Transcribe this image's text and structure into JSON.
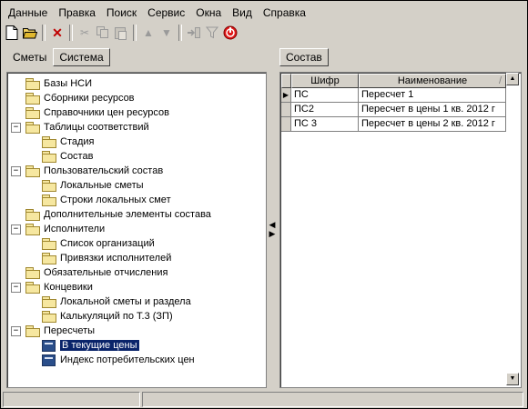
{
  "menu": [
    "Данные",
    "Правка",
    "Поиск",
    "Сервис",
    "Окна",
    "Вид",
    "Справка"
  ],
  "toolbar": {
    "icons": [
      "new-document-icon",
      "open-folder-icon",
      "delete-icon",
      "cut-icon",
      "copy-icon",
      "paste-icon",
      "move-up-icon",
      "move-down-icon",
      "import-icon",
      "filter-icon",
      "stop-icon"
    ]
  },
  "left_tabs": [
    "Сметы",
    "Система"
  ],
  "right_tab": "Состав",
  "tree": [
    {
      "label": "Базы НСИ",
      "level": 0,
      "expander": "",
      "icon": "folder"
    },
    {
      "label": "Сборники ресурсов",
      "level": 0,
      "expander": "",
      "icon": "folder"
    },
    {
      "label": "Справочники цен ресурсов",
      "level": 0,
      "expander": "",
      "icon": "folder"
    },
    {
      "label": "Таблицы соответствий",
      "level": 0,
      "expander": "−",
      "icon": "folder"
    },
    {
      "label": "Стадия",
      "level": 1,
      "expander": "",
      "icon": "folder"
    },
    {
      "label": "Состав",
      "level": 1,
      "expander": "",
      "icon": "folder"
    },
    {
      "label": "Пользовательский состав",
      "level": 0,
      "expander": "−",
      "icon": "folder"
    },
    {
      "label": "Локальные сметы",
      "level": 1,
      "expander": "",
      "icon": "folder"
    },
    {
      "label": "Строки локальных смет",
      "level": 1,
      "expander": "",
      "icon": "folder"
    },
    {
      "label": "Дополнительные элементы состава",
      "level": 0,
      "expander": "",
      "icon": "folder"
    },
    {
      "label": "Исполнители",
      "level": 0,
      "expander": "−",
      "icon": "folder"
    },
    {
      "label": "Список организаций",
      "level": 1,
      "expander": "",
      "icon": "folder"
    },
    {
      "label": "Привязки исполнителей",
      "level": 1,
      "expander": "",
      "icon": "folder"
    },
    {
      "label": "Обязательные отчисления",
      "level": 0,
      "expander": "",
      "icon": "folder"
    },
    {
      "label": "Концевики",
      "level": 0,
      "expander": "−",
      "icon": "folder"
    },
    {
      "label": "Локальной сметы и раздела",
      "level": 1,
      "expander": "",
      "icon": "folder"
    },
    {
      "label": "Калькуляций по Т.3 (ЗП)",
      "level": 1,
      "expander": "",
      "icon": "folder"
    },
    {
      "label": "Пересчеты",
      "level": 0,
      "expander": "−",
      "icon": "folder"
    },
    {
      "label": "В текущие цены",
      "level": 1,
      "expander": "",
      "icon": "calc",
      "selected": true
    },
    {
      "label": "Индекс потребительских цен",
      "level": 1,
      "expander": "",
      "icon": "calc"
    }
  ],
  "grid": {
    "columns": [
      "Шифр",
      "Наименование"
    ],
    "rows": [
      {
        "code": "ПС",
        "name": "Пересчет 1",
        "current": true
      },
      {
        "code": "ПС2",
        "name": "Пересчет в цены 1 кв. 2012 г"
      },
      {
        "code": "ПС 3",
        "name": "Пересчет в цены 2 кв. 2012 г"
      }
    ]
  }
}
